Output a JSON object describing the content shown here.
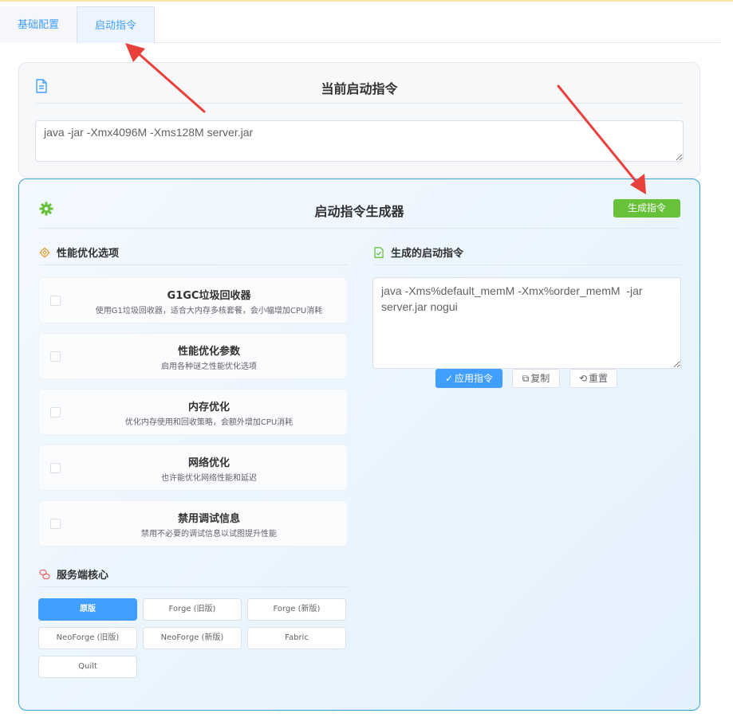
{
  "tabs": [
    {
      "label": "基础配置"
    },
    {
      "label": "启动指令"
    }
  ],
  "current": {
    "title": "当前启动指令",
    "command": "java -jar -Xmx4096M -Xms128M server.jar",
    "icon": "document-icon"
  },
  "generator": {
    "title": "启动指令生成器",
    "generate_label": "生成指令",
    "icon": "gear-icon",
    "perf_section": "性能优化选项",
    "output_section": "生成的启动指令",
    "core_section": "服务端核心",
    "options": [
      {
        "title": "G1GC垃圾回收器",
        "desc": "使用G1垃圾回收器，适合大内存多核套餐，会小幅增加CPU消耗"
      },
      {
        "title": "性能优化参数",
        "desc": "启用各种谜之性能优化选项"
      },
      {
        "title": "内存优化",
        "desc": "优化内存使用和回收策略，会额外增加CPU消耗"
      },
      {
        "title": "网络优化",
        "desc": "也许能优化网络性能和延迟"
      },
      {
        "title": "禁用调试信息",
        "desc": "禁用不必要的调试信息以试图提升性能"
      }
    ],
    "cores": [
      {
        "label": "原版"
      },
      {
        "label": "Forge (旧版)"
      },
      {
        "label": "Forge (新版)"
      },
      {
        "label": "NeoForge (旧版)"
      },
      {
        "label": "NeoForge (新版)"
      },
      {
        "label": "Fabric"
      },
      {
        "label": "Quilt"
      }
    ],
    "generated_command": "java -Xms%default_memM -Xmx%order_memM  -jar server.jar nogui",
    "apply_label": "应用指令",
    "copy_label": "复制",
    "reset_label": "重置"
  },
  "colors": {
    "accent": "#409eff",
    "success": "#67c23a",
    "annotation": "#e8403a"
  }
}
